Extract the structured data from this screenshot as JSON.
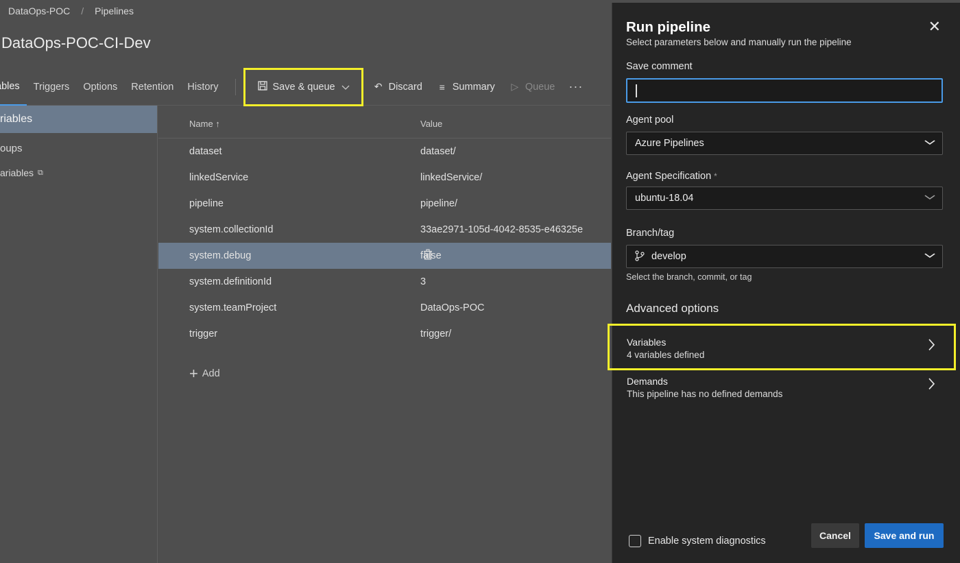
{
  "breadcrumb": {
    "project": "DataOps-POC",
    "separator": "/",
    "section": "Pipelines"
  },
  "page": {
    "title": "DataOps-POC-CI-Dev"
  },
  "tabs": [
    {
      "label": "ables"
    },
    {
      "label": "Triggers"
    },
    {
      "label": "Options"
    },
    {
      "label": "Retention"
    },
    {
      "label": "History"
    }
  ],
  "toolbar": {
    "save_queue": "Save & queue",
    "discard": "Discard",
    "summary": "Summary",
    "queue": "Queue",
    "more": "···"
  },
  "leftnav": {
    "items": [
      {
        "label": "riables"
      },
      {
        "label": "oups"
      },
      {
        "label": "ariables"
      }
    ]
  },
  "variables_table": {
    "headers": {
      "name": "Name ↑",
      "value": "Value"
    },
    "rows": [
      {
        "name": "dataset",
        "value": "dataset/"
      },
      {
        "name": "linkedService",
        "value": "linkedService/"
      },
      {
        "name": "pipeline",
        "value": "pipeline/"
      },
      {
        "name": "system.collectionId",
        "value": "33ae2971-105d-4042-8535-e46325e"
      },
      {
        "name": "system.debug",
        "value": "false"
      },
      {
        "name": "system.definitionId",
        "value": "3"
      },
      {
        "name": "system.teamProject",
        "value": "DataOps-POC"
      },
      {
        "name": "trigger",
        "value": "trigger/"
      }
    ],
    "add_label": "Add"
  },
  "panel": {
    "title": "Run pipeline",
    "subtitle": "Select parameters below and manually run the pipeline",
    "save_comment": {
      "label": "Save comment",
      "value": ""
    },
    "agent_pool": {
      "label": "Agent pool",
      "value": "Azure Pipelines"
    },
    "agent_spec": {
      "label": "Agent Specification",
      "required_mark": "*",
      "value": "ubuntu-18.04"
    },
    "branch": {
      "label": "Branch/tag",
      "value": "develop",
      "hint": "Select the branch, commit, or tag"
    },
    "advanced_heading": "Advanced options",
    "variables": {
      "title": "Variables",
      "subtitle": "4 variables defined"
    },
    "demands": {
      "title": "Demands",
      "subtitle": "This pipeline has no defined demands"
    },
    "diagnostics_label": "Enable system diagnostics",
    "cancel_label": "Cancel",
    "run_label": "Save and run"
  },
  "colors": {
    "highlight": "#f4ef2a",
    "primary": "#1e6bc2",
    "selection": "#6b7b8e"
  }
}
